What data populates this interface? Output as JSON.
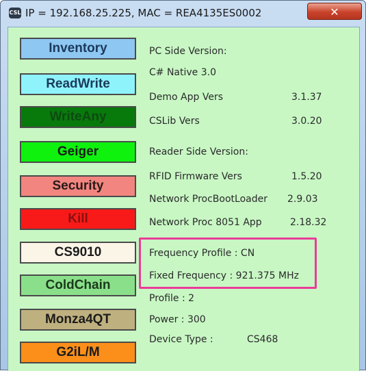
{
  "window": {
    "title": "IP = 192.168.25.225, MAC = REA4135ES0002",
    "icon": "CSL",
    "close_label": "✕"
  },
  "buttons": [
    {
      "label": "Inventory",
      "color": "#8ec7f2",
      "text_color": "#1b3a5c"
    },
    {
      "label": "ReadWrite",
      "color": "#8ef3fb",
      "text_color": "#1b3a5c"
    },
    {
      "label": "WriteAny",
      "color": "#087a0c",
      "text_color": "#0f4a12"
    },
    {
      "label": "Geiger",
      "color": "#0ef20e",
      "text_color": "#1b1b1b"
    },
    {
      "label": "Security",
      "color": "#f2857f",
      "text_color": "#2a1a1a"
    },
    {
      "label": "Kill",
      "color": "#f81a18",
      "text_color": "#8a1010"
    },
    {
      "label": "CS9010",
      "color": "#fbf5e8",
      "text_color": "#1b1b1b"
    },
    {
      "label": "ColdChain",
      "color": "#8ae08a",
      "text_color": "#1b3a1b"
    },
    {
      "label": "Monza4QT",
      "color": "#bfb17f",
      "text_color": "#1b1b1b"
    },
    {
      "label": "G2iL/M",
      "color": "#fb8f1a",
      "text_color": "#1b1b1b"
    }
  ],
  "info": {
    "pc_side_version": "PC Side Version:",
    "csharp_native": "C# Native 3.0",
    "demo_app_label": "Demo App Vers",
    "demo_app_value": "3.1.37",
    "cslib_label": "CSLib Vers",
    "cslib_value": "3.0.20",
    "reader_side_version": "Reader Side Version:",
    "rfid_fw_label": "RFID Firmware Vers",
    "rfid_fw_value": "1.5.20",
    "net_boot_label": "Network ProcBootLoader",
    "net_boot_value": "2.9.03",
    "net_proc_label": "Network Proc  8051 App",
    "net_proc_value": "2.18.32",
    "frequency_profile": "Frequency Profile : CN",
    "fixed_frequency": "Fixed Frequency : 921.375 MHz",
    "profile": "Profile : 2",
    "power": "Power : 300",
    "device_type_label": "Device Type :",
    "device_type_value": "CS468"
  },
  "highlight_color": "#ea3b98"
}
